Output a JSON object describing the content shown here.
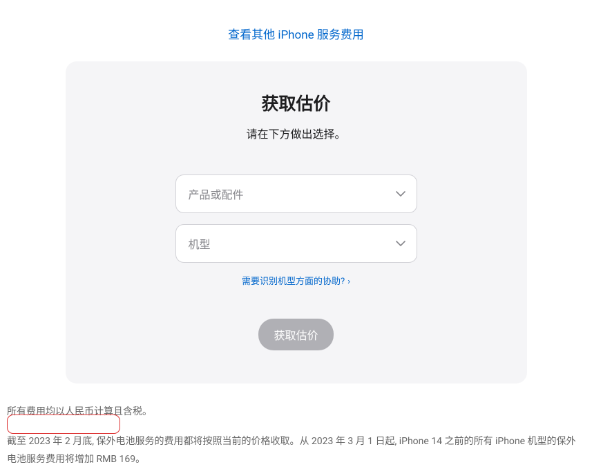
{
  "topLink": "查看其他 iPhone 服务费用",
  "card": {
    "title": "获取估价",
    "subtitle": "请在下方做出选择。",
    "select1Placeholder": "产品或配件",
    "select2Placeholder": "机型",
    "helpLink": "需要识别机型方面的协助?",
    "button": "获取估价"
  },
  "footer": {
    "line1": "所有费用均以人民币计算且含税。",
    "line2": "截至 2023 年 2 月底, 保外电池服务的费用都将按照当前的价格收取。从 2023 年 3 月 1 日起, iPhone 14 之前的所有 iPhone 机型的保外电池服务费用将增加 RMB 169。"
  }
}
